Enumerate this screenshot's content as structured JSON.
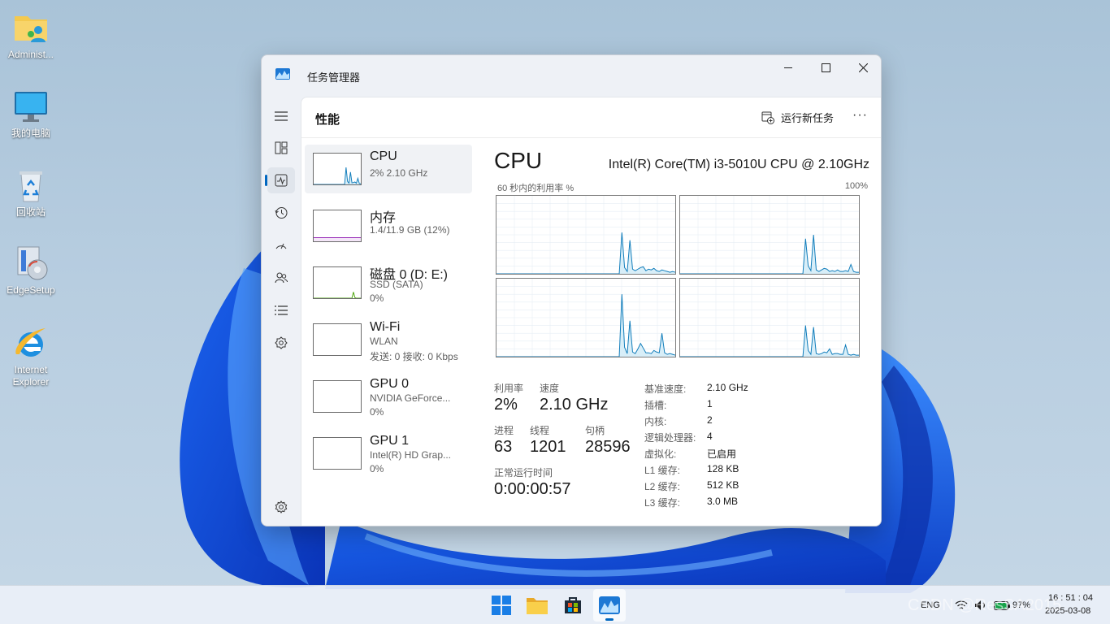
{
  "desktop": {
    "icons": [
      {
        "label": "Administ...",
        "icon": "user-folder-icon"
      },
      {
        "label": "我的电脑",
        "icon": "monitor-icon"
      },
      {
        "label": "回收站",
        "icon": "recycle-bin-icon"
      },
      {
        "label": "EdgeSetup",
        "icon": "installer-icon"
      },
      {
        "label": "Internet Explorer",
        "icon": "ie-icon"
      }
    ]
  },
  "window": {
    "title": "任务管理器",
    "controls": {
      "minimize": "—",
      "maximize": "☐",
      "close": "✕"
    },
    "page_title": "性能",
    "run_task_label": "运行新任务",
    "more_label": "···"
  },
  "nav": [
    {
      "name": "menu",
      "icon": "hamburger-icon"
    },
    {
      "name": "processes",
      "icon": "processes-icon"
    },
    {
      "name": "performance",
      "icon": "performance-icon",
      "active": true
    },
    {
      "name": "app-history",
      "icon": "history-icon"
    },
    {
      "name": "startup",
      "icon": "startup-icon"
    },
    {
      "name": "users",
      "icon": "users-icon"
    },
    {
      "name": "details",
      "icon": "details-icon"
    },
    {
      "name": "services",
      "icon": "services-icon"
    },
    {
      "name": "settings",
      "icon": "settings-icon"
    }
  ],
  "devices": [
    {
      "name": "CPU",
      "line1": "2% 2.10 GHz",
      "line2": ""
    },
    {
      "name": "内存",
      "line1": "1.4/11.9 GB (12%)",
      "line2": ""
    },
    {
      "name": "磁盘 0 (D: E:)",
      "line1": "SSD (SATA)",
      "line2": "0%"
    },
    {
      "name": "Wi-Fi",
      "line1": "WLAN",
      "line2": "发送: 0 接收: 0 Kbps"
    },
    {
      "name": "GPU 0",
      "line1": "NVIDIA GeForce...",
      "line2": "0%"
    },
    {
      "name": "GPU 1",
      "line1": "Intel(R) HD Grap...",
      "line2": "0%"
    }
  ],
  "cpu": {
    "title": "CPU",
    "model": "Intel(R) Core(TM) i3-5010U CPU @ 2.10GHz",
    "graph_label": "60 秒内的利用率 %",
    "graph_max": "100%",
    "stats": {
      "util_label": "利用率",
      "util_value": "2%",
      "speed_label": "速度",
      "speed_value": "2.10 GHz",
      "proc_label": "进程",
      "proc_value": "63",
      "thread_label": "线程",
      "thread_value": "1201",
      "handle_label": "句柄",
      "handle_value": "28596",
      "uptime_label": "正常运行时间",
      "uptime_value": "0:00:00:57"
    },
    "specs": [
      {
        "label": "基准速度:",
        "value": "2.10 GHz"
      },
      {
        "label": "插槽:",
        "value": "1"
      },
      {
        "label": "内核:",
        "value": "2"
      },
      {
        "label": "逻辑处理器:",
        "value": "4"
      },
      {
        "label": "虚拟化:",
        "value": "已启用"
      },
      {
        "label": "L1 缓存:",
        "value": "128 KB"
      },
      {
        "label": "L2 缓存:",
        "value": "512 KB"
      },
      {
        "label": "L3 缓存:",
        "value": "3.0 MB"
      }
    ],
    "core_utilization_percent": [
      [
        0,
        0,
        0,
        0,
        0,
        0,
        0,
        0,
        0,
        0,
        0,
        0,
        0,
        0,
        0,
        0,
        0,
        0,
        0,
        0,
        0,
        0,
        0,
        0,
        0,
        0,
        0,
        0,
        0,
        0,
        0,
        0,
        0,
        0,
        0,
        0,
        0,
        0,
        0,
        0,
        0,
        0,
        0,
        0,
        0,
        0,
        0,
        53,
        8,
        3,
        43,
        6,
        4,
        6,
        8,
        9,
        4,
        6,
        5,
        7,
        4,
        3,
        5,
        4,
        3,
        2,
        3,
        2
      ],
      [
        0,
        0,
        0,
        0,
        0,
        0,
        0,
        0,
        0,
        0,
        0,
        0,
        0,
        0,
        0,
        0,
        0,
        0,
        0,
        0,
        0,
        0,
        0,
        0,
        0,
        0,
        0,
        0,
        0,
        0,
        0,
        0,
        0,
        0,
        0,
        0,
        0,
        0,
        0,
        0,
        0,
        0,
        0,
        0,
        0,
        0,
        0,
        45,
        10,
        4,
        50,
        5,
        3,
        5,
        7,
        6,
        3,
        4,
        3,
        5,
        3,
        3,
        4,
        3,
        12,
        3,
        2,
        2
      ],
      [
        0,
        0,
        0,
        0,
        0,
        0,
        0,
        0,
        0,
        0,
        0,
        0,
        0,
        0,
        0,
        0,
        0,
        0,
        0,
        0,
        0,
        0,
        0,
        0,
        0,
        0,
        0,
        0,
        0,
        0,
        0,
        0,
        0,
        0,
        0,
        0,
        0,
        0,
        0,
        0,
        0,
        0,
        0,
        0,
        0,
        0,
        0,
        80,
        12,
        4,
        46,
        6,
        4,
        10,
        17,
        11,
        5,
        5,
        4,
        8,
        6,
        5,
        30,
        5,
        3,
        4,
        3,
        2
      ],
      [
        0,
        0,
        0,
        0,
        0,
        0,
        0,
        0,
        0,
        0,
        0,
        0,
        0,
        0,
        0,
        0,
        0,
        0,
        0,
        0,
        0,
        0,
        0,
        0,
        0,
        0,
        0,
        0,
        0,
        0,
        0,
        0,
        0,
        0,
        0,
        0,
        0,
        0,
        0,
        0,
        0,
        0,
        0,
        0,
        0,
        0,
        0,
        40,
        8,
        3,
        38,
        4,
        3,
        4,
        6,
        5,
        10,
        3,
        4,
        4,
        3,
        3,
        15,
        3,
        2,
        3,
        2,
        2
      ]
    ]
  },
  "thumbnails": {
    "cpu_percent": [
      0,
      0,
      0,
      0,
      0,
      0,
      0,
      0,
      0,
      0,
      0,
      0,
      0,
      0,
      0,
      0,
      0,
      0,
      0,
      0,
      0,
      0,
      55,
      10,
      4,
      40,
      5,
      6,
      8,
      4,
      20,
      3,
      2
    ],
    "memory_percent": 12,
    "disk_percent": [
      0,
      0,
      0,
      0,
      0,
      0,
      0,
      0,
      0,
      0,
      0,
      0,
      0,
      0,
      0,
      0,
      0,
      0,
      0,
      0,
      0,
      0,
      0,
      0,
      0,
      0,
      0,
      20,
      2,
      0,
      0,
      0,
      0
    ]
  },
  "colors": {
    "accent": "#0067c0",
    "cpu_line": "#117dbb",
    "cpu_fill": "#d8eef8",
    "mem_line": "#8b12ae",
    "disk_line": "#4da60c"
  },
  "taskbar": {
    "apps": [
      {
        "name": "start",
        "icon": "windows-logo-icon"
      },
      {
        "name": "file-explorer",
        "icon": "folder-icon"
      },
      {
        "name": "store",
        "icon": "store-icon"
      },
      {
        "name": "task-manager",
        "icon": "task-manager-icon",
        "active": true
      }
    ],
    "tray": {
      "lang": "ENG",
      "battery": "97%",
      "time": "16 : 51 : 04",
      "date": "2025-03-08"
    },
    "watermark": "CSDN @ResSA2015"
  }
}
